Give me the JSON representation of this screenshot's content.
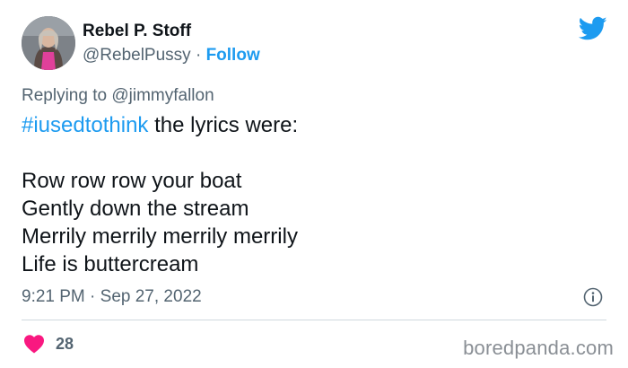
{
  "author": {
    "name": "Rebel P. Stoff",
    "handle": "@RebelPussy",
    "separator": "·",
    "follow_label": "Follow"
  },
  "reply": {
    "prefix": "Replying to",
    "mention": "@jimmyfallon"
  },
  "tweet": {
    "hashtag": "#iusedtothink",
    "intro": " the lyrics were:",
    "lyrics": [
      "Row row row your boat",
      "Gently down the stream",
      "Merrily merrily merrily merrily",
      "Life is buttercream"
    ]
  },
  "meta": {
    "time": "9:21 PM",
    "separator": "·",
    "date": "Sep 27, 2022"
  },
  "engagement": {
    "likes": "28"
  },
  "watermark": "boredpanda.com",
  "icons": {
    "brand": "twitter-bird-icon",
    "like": "heart-icon",
    "info": "info-icon"
  },
  "colors": {
    "accent": "#1d9bf0",
    "like": "#f91880",
    "muted": "#536471",
    "text": "#0f1419"
  }
}
